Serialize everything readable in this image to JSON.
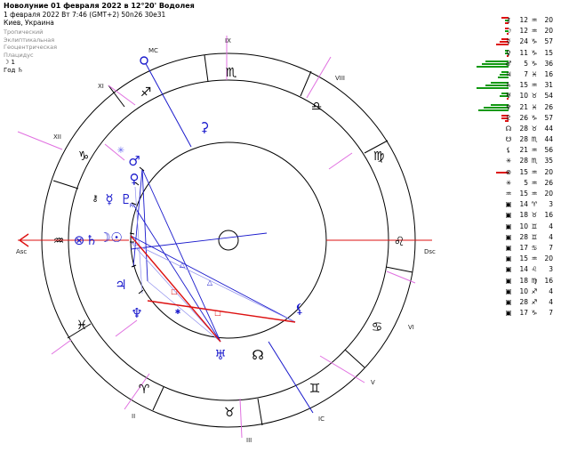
{
  "header": {
    "title": "Новолуние 01 февраля 2022 в 12°20' Водолея",
    "line2": "1 февраля 2022  Вт  7:46 (GMT+2) 50n26  30e31",
    "line3": "Киев, Украина"
  },
  "settings": [
    "Тропический",
    "Эклиптикальная",
    "Геоцентрическая",
    "Плацидус"
  ],
  "year_info": {
    "line1": "☽  1",
    "line2": "Год  ♄"
  },
  "wheel": {
    "house_labels": {
      "mc": "MC",
      "ic": "IC",
      "asc": "Asc",
      "dsc": "Dsc",
      "h2": "II",
      "h3": "III",
      "h5": "V",
      "h6": "VI",
      "h8": "VIII",
      "h9": "IX",
      "h11": "XI",
      "h12": "XII"
    },
    "signs": {
      "aqr": "♒",
      "cap": "♑",
      "sgr": "♐",
      "sco": "♏",
      "lib": "♎",
      "vir": "♍",
      "leo": "♌",
      "cnc": "♋",
      "gem": "♊",
      "tau": "♉",
      "ari": "♈",
      "psc": "♓"
    },
    "planets": {
      "sun": "☉",
      "moon": "☽",
      "mercury": "☿",
      "venus": "♀",
      "mars": "♂",
      "jupiter": "♃",
      "saturn": "♄",
      "uranus": "♅",
      "neptune": "♆",
      "pluto": "♇",
      "north_node": "☊",
      "lilith": "⚸",
      "chiron": "⚷",
      "fortuna": "⊗",
      "selena": "✳",
      "ceres": "⚳",
      "r_mark": "R",
      "retro_marker": "R"
    },
    "aspect_markers": {
      "trine": "△",
      "square": "□",
      "sextile": "✱"
    }
  },
  "planet_list": [
    {
      "glyph": "⚷",
      "deg": "12",
      "sign": "♒",
      "min": "20",
      "bars": [
        [
          "r",
          8,
          0
        ],
        [
          "g",
          4,
          3
        ],
        [
          "r",
          4,
          6
        ]
      ]
    },
    {
      "glyph": "☽",
      "deg": "12",
      "sign": "♒",
      "min": "20",
      "bars": [
        [
          "r",
          4,
          0
        ],
        [
          "g",
          4,
          3
        ],
        [
          "r",
          2,
          6
        ]
      ]
    },
    {
      "glyph": "☿",
      "deg": "24",
      "sign": "♑",
      "min": "57",
      "bars": [
        [
          "r",
          8,
          0
        ],
        [
          "r",
          10,
          3
        ],
        [
          "r",
          14,
          6
        ]
      ]
    },
    {
      "glyph": "♀",
      "deg": "11",
      "sign": "♑",
      "min": "15",
      "bars": [
        [
          "g",
          4,
          0
        ],
        [
          "g",
          4,
          3
        ],
        [
          "r",
          2,
          6
        ]
      ]
    },
    {
      "glyph": "♂",
      "deg": "5",
      "sign": "♑",
      "min": "36",
      "bars": [
        [
          "g",
          26,
          0
        ],
        [
          "g",
          30,
          3
        ],
        [
          "g",
          36,
          6
        ]
      ]
    },
    {
      "glyph": "♃",
      "deg": "7",
      "sign": "♓",
      "min": "16",
      "bars": [
        [
          "g",
          8,
          0
        ],
        [
          "g",
          10,
          3
        ],
        [
          "g",
          12,
          6
        ]
      ]
    },
    {
      "glyph": "♄",
      "deg": "15",
      "sign": "♒",
      "min": "31",
      "bars": [
        [
          "g",
          20,
          0
        ],
        [
          "g",
          26,
          3
        ],
        [
          "g",
          36,
          6
        ]
      ]
    },
    {
      "glyph": "♅",
      "deg": "10",
      "sign": "♉",
      "min": "54",
      "bars": [
        [
          "g",
          8,
          0
        ],
        [
          "g",
          10,
          3
        ],
        [
          "r",
          2,
          6
        ]
      ]
    },
    {
      "glyph": "♆",
      "deg": "21",
      "sign": "♓",
      "min": "26",
      "bars": [
        [
          "g",
          20,
          0
        ],
        [
          "g",
          28,
          3
        ],
        [
          "g",
          34,
          6
        ]
      ]
    },
    {
      "glyph": "♇",
      "deg": "26",
      "sign": "♑",
      "min": "57",
      "bars": [
        [
          "r",
          8,
          0
        ],
        [
          "r",
          8,
          3
        ],
        [
          "r",
          4,
          6
        ]
      ]
    },
    {
      "glyph": "☊",
      "deg": "28",
      "sign": "♉",
      "min": "44",
      "bars": []
    },
    {
      "glyph": "☋",
      "deg": "28",
      "sign": "♏",
      "min": "44",
      "bars": []
    },
    {
      "glyph": "⚸",
      "deg": "21",
      "sign": "♒",
      "min": "56",
      "bars": []
    },
    {
      "glyph": "✳",
      "deg": "28",
      "sign": "♏",
      "min": "35",
      "bars": []
    },
    {
      "glyph": "⊗",
      "deg": "15",
      "sign": "♒",
      "min": "20",
      "bars": [
        [
          "r",
          14,
          3
        ]
      ]
    },
    {
      "glyph": "✳",
      "deg": "5",
      "sign": "♒",
      "min": "26",
      "bars": []
    },
    {
      "glyph": "♒",
      "deg": "15",
      "sign": "♒",
      "min": "20",
      "bars": []
    },
    {
      "glyph": "▣",
      "deg": "14",
      "sign": "♈",
      "min": "3",
      "bars": []
    },
    {
      "glyph": "▣",
      "deg": "18",
      "sign": "♉",
      "min": "16",
      "bars": []
    },
    {
      "glyph": "▣",
      "deg": "10",
      "sign": "♊",
      "min": "4",
      "bars": []
    },
    {
      "glyph": "▣",
      "deg": "28",
      "sign": "♊",
      "min": "4",
      "bars": []
    },
    {
      "glyph": "▣",
      "deg": "17",
      "sign": "♋",
      "min": "7",
      "bars": []
    },
    {
      "glyph": "▣",
      "deg": "15",
      "sign": "♒",
      "min": "20",
      "bars": []
    },
    {
      "glyph": "▣",
      "deg": "14",
      "sign": "♌",
      "min": "3",
      "bars": []
    },
    {
      "glyph": "▣",
      "deg": "18",
      "sign": "♍",
      "min": "16",
      "bars": []
    },
    {
      "glyph": "▣",
      "deg": "10",
      "sign": "♐",
      "min": "4",
      "bars": []
    },
    {
      "glyph": "▣",
      "deg": "28",
      "sign": "♐",
      "min": "4",
      "bars": []
    },
    {
      "glyph": "▣",
      "deg": "17",
      "sign": "♑",
      "min": "7",
      "bars": []
    }
  ]
}
